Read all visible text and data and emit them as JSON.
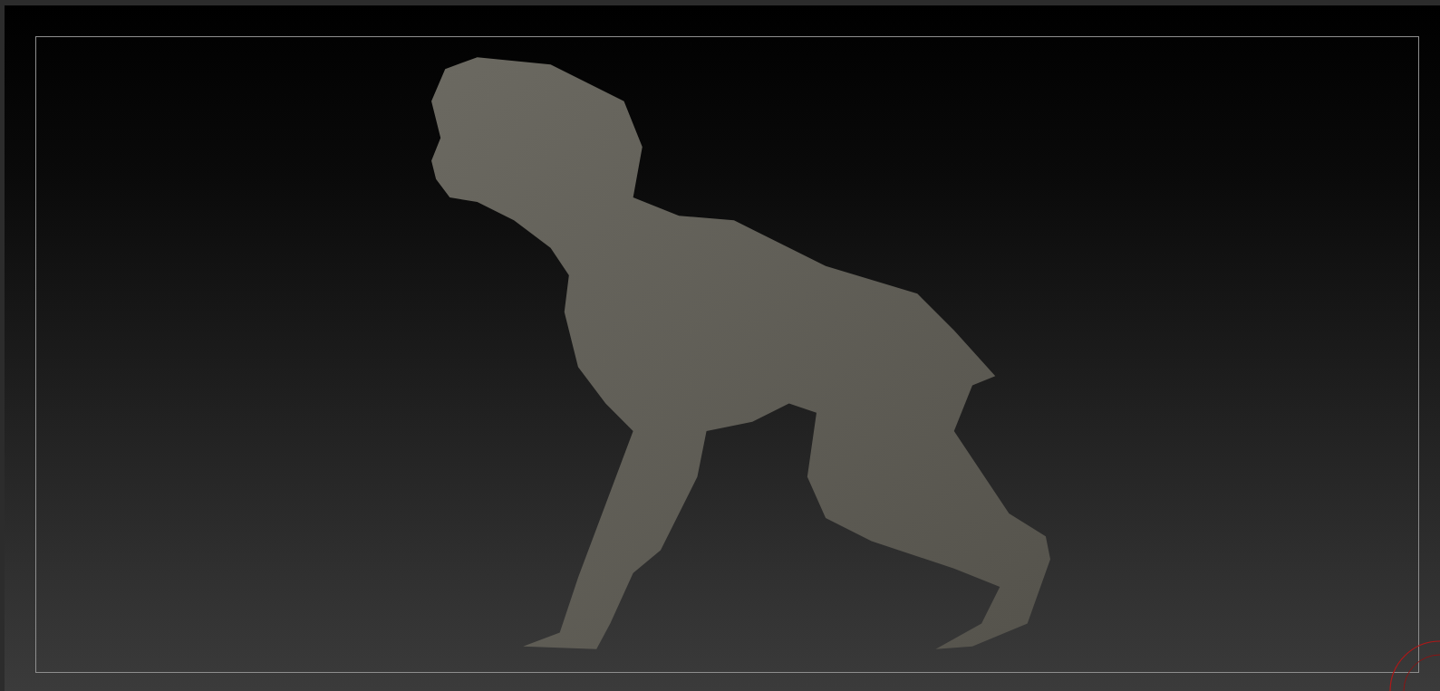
{
  "viewport": {
    "show_frame": true
  }
}
